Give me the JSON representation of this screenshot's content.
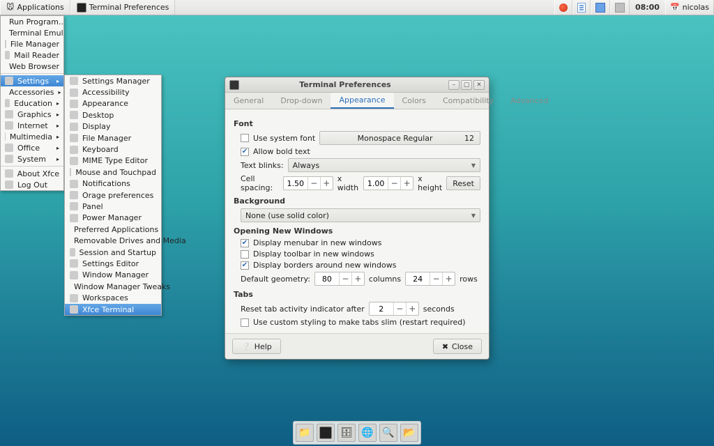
{
  "panel": {
    "apps_label": "Applications",
    "task_label": "Terminal Preferences",
    "clock": "08:00",
    "user": "nicolas"
  },
  "appmenu": {
    "items": [
      {
        "label": "Run Program...",
        "sub": false
      },
      {
        "label": "Terminal Emulator",
        "sub": false
      },
      {
        "label": "File Manager",
        "sub": false
      },
      {
        "label": "Mail Reader",
        "sub": false
      },
      {
        "label": "Web Browser",
        "sub": false
      },
      {
        "sep": true
      },
      {
        "label": "Settings",
        "sub": true,
        "selected": true
      },
      {
        "label": "Accessories",
        "sub": true
      },
      {
        "label": "Education",
        "sub": true
      },
      {
        "label": "Graphics",
        "sub": true
      },
      {
        "label": "Internet",
        "sub": true
      },
      {
        "label": "Multimedia",
        "sub": true
      },
      {
        "label": "Office",
        "sub": true
      },
      {
        "label": "System",
        "sub": true
      },
      {
        "sep": true
      },
      {
        "label": "About Xfce",
        "sub": false
      },
      {
        "label": "Log Out",
        "sub": false
      }
    ]
  },
  "submenu": {
    "items": [
      "Settings Manager",
      "Accessibility",
      "Appearance",
      "Desktop",
      "Display",
      "File Manager",
      "Keyboard",
      "MIME Type Editor",
      "Mouse and Touchpad",
      "Notifications",
      "Orage preferences",
      "Panel",
      "Power Manager",
      "Preferred Applications",
      "Removable Drives and Media",
      "Session and Startup",
      "Settings Editor",
      "Window Manager",
      "Window Manager Tweaks",
      "Workspaces",
      "Xfce Terminal"
    ],
    "selected_index": 20
  },
  "dialog": {
    "title": "Terminal Preferences",
    "tabs": [
      "General",
      "Drop-down",
      "Appearance",
      "Colors",
      "Compatibility",
      "Advanced"
    ],
    "active_tab": 2,
    "font": {
      "section": "Font",
      "use_system_font_label": "Use system font",
      "use_system_font": false,
      "font_name": "Monospace Regular",
      "font_size": "12",
      "allow_bold_label": "Allow bold text",
      "allow_bold": true,
      "text_blinks_label": "Text blinks:",
      "text_blinks_value": "Always",
      "cell_spacing_label": "Cell spacing:",
      "cell_w": "1.50",
      "x_width": "x width",
      "cell_h": "1.00",
      "x_height": "x height",
      "reset": "Reset"
    },
    "background": {
      "section": "Background",
      "mode": "None (use solid color)"
    },
    "opening": {
      "section": "Opening New Windows",
      "menubar_label": "Display menubar in new windows",
      "menubar": true,
      "toolbar_label": "Display toolbar in new windows",
      "toolbar": false,
      "borders_label": "Display borders around new windows",
      "borders": true,
      "geometry_label": "Default geometry:",
      "cols": "80",
      "cols_label": "columns",
      "rows": "24",
      "rows_label": "rows"
    },
    "tabs_section": {
      "section": "Tabs",
      "reset_label": "Reset tab activity indicator after",
      "seconds_value": "2",
      "seconds_label": "seconds",
      "slim_label": "Use custom styling to make tabs slim (restart required)",
      "slim": false
    },
    "footer": {
      "help": "Help",
      "close": "Close"
    }
  }
}
